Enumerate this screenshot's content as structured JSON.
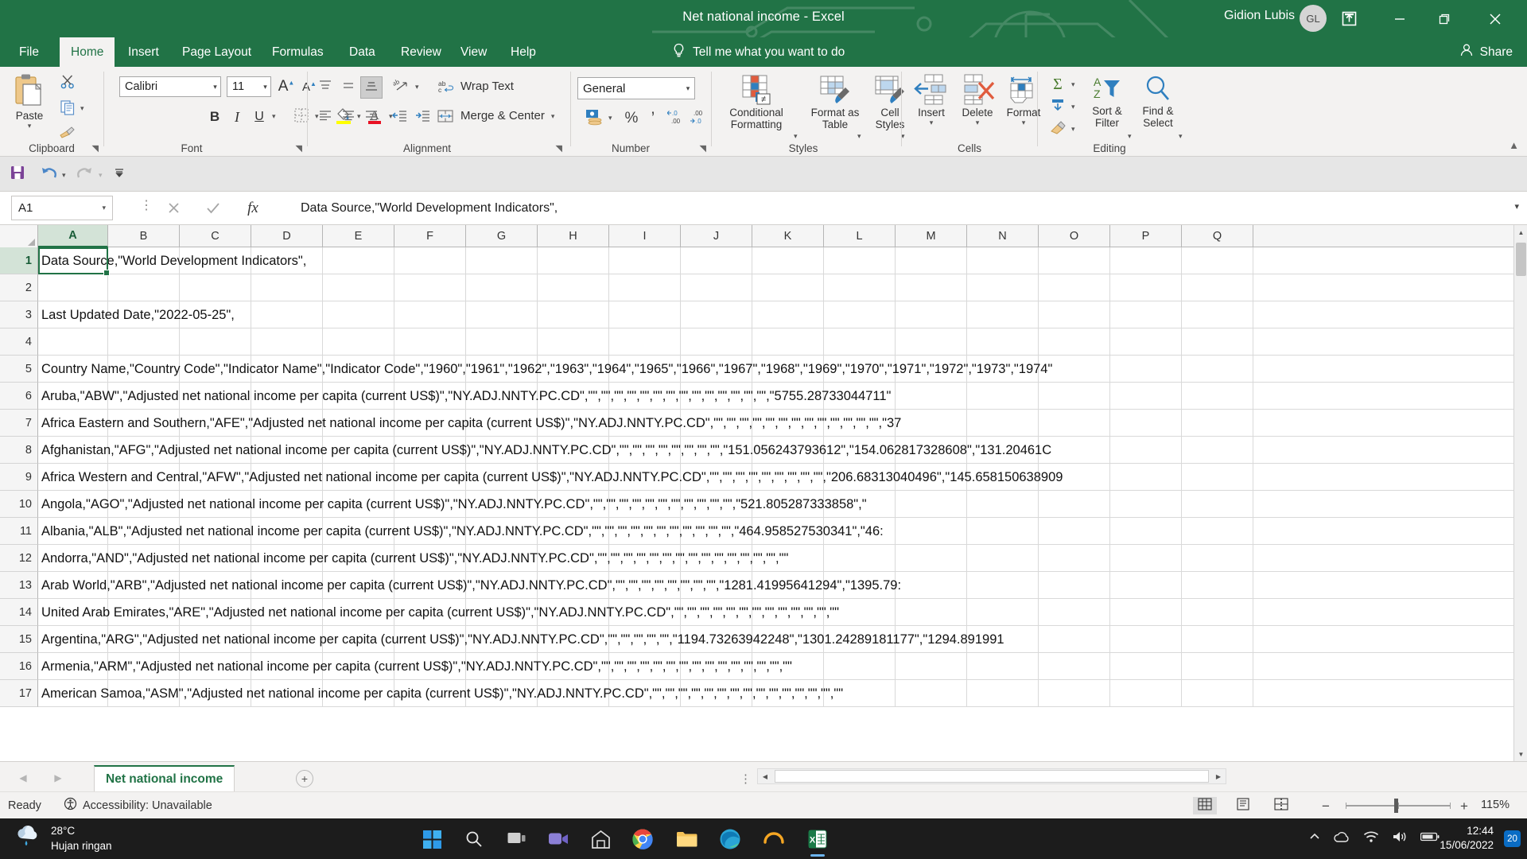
{
  "titlebar": {
    "title": "Net national income  -  Excel",
    "user": "Gidion Lubis",
    "avatar_initials": "GL",
    "ribbon_display_icon": "ribbon-display-options-icon",
    "minimize_icon": "minimize-icon",
    "restore_icon": "restore-icon",
    "close_icon": "close-icon",
    "accent_color": "#217346"
  },
  "tabs": [
    {
      "label": "File",
      "active": false
    },
    {
      "label": "Home",
      "active": true
    },
    {
      "label": "Insert",
      "active": false
    },
    {
      "label": "Page Layout",
      "active": false
    },
    {
      "label": "Formulas",
      "active": false
    },
    {
      "label": "Data",
      "active": false
    },
    {
      "label": "Review",
      "active": false
    },
    {
      "label": "View",
      "active": false
    },
    {
      "label": "Help",
      "active": false
    }
  ],
  "tellme": {
    "label": "Tell me what you want to do",
    "icon": "lightbulb-icon"
  },
  "share": {
    "label": "Share",
    "icon": "share-person-icon"
  },
  "ribbon": {
    "groups": [
      {
        "name": "Clipboard",
        "label": "Clipboard",
        "has_launcher": true
      },
      {
        "name": "Font",
        "label": "Font",
        "has_launcher": true
      },
      {
        "name": "Alignment",
        "label": "Alignment",
        "has_launcher": true
      },
      {
        "name": "Number",
        "label": "Number",
        "has_launcher": true
      },
      {
        "name": "Styles",
        "label": "Styles",
        "has_launcher": false
      },
      {
        "name": "Cells",
        "label": "Cells",
        "has_launcher": false
      },
      {
        "name": "Editing",
        "label": "Editing",
        "has_launcher": false
      }
    ],
    "clipboard": {
      "paste_label": "Paste",
      "paste_icon": "paste-clipboard-icon",
      "cut_icon": "scissors-icon",
      "copy_icon": "copy-icon",
      "format_painter_icon": "format-painter-icon"
    },
    "font": {
      "font_name": "Calibri",
      "font_size": "11",
      "grow_font_icon": "increase-font-size-icon",
      "shrink_font_icon": "decrease-font-size-icon",
      "bold_label": "B",
      "italic_label": "I",
      "underline_label": "U",
      "borders_icon": "borders-icon",
      "fill_color_icon": "fill-color-icon",
      "font_color_icon": "font-color-icon"
    },
    "alignment": {
      "top_align_icon": "align-top-icon",
      "middle_align_icon": "align-middle-icon",
      "bottom_align_icon": "align-bottom-icon",
      "orientation_icon": "text-orientation-icon",
      "wrap_text_label": "Wrap Text",
      "wrap_text_icon": "wrap-text-icon",
      "align_left_icon": "align-left-icon",
      "align_center_icon": "align-center-icon",
      "align_right_icon": "align-right-icon",
      "decrease_indent_icon": "decrease-indent-icon",
      "increase_indent_icon": "increase-indent-icon",
      "merge_center_label": "Merge & Center",
      "merge_center_icon": "merge-cells-icon"
    },
    "number": {
      "format_value": "General",
      "accounting_icon": "accounting-number-format-icon",
      "percent_label": "%",
      "comma_label": "’",
      "increase_decimal_icon": "increase-decimal-icon",
      "decrease_decimal_icon": "decrease-decimal-icon"
    },
    "styles": {
      "conditional_formatting_label": "Conditional\nFormatting",
      "conditional_formatting_l1": "Conditional",
      "conditional_formatting_l2": "Formatting",
      "conditional_formatting_icon": "conditional-formatting-icon",
      "format_as_table_l1": "Format as",
      "format_as_table_l2": "Table",
      "format_as_table_icon": "format-as-table-icon",
      "cell_styles_l1": "Cell",
      "cell_styles_l2": "Styles",
      "cell_styles_icon": "cell-styles-icon"
    },
    "cells": {
      "insert_label": "Insert",
      "insert_icon": "insert-cells-icon",
      "delete_label": "Delete",
      "delete_icon": "delete-cells-icon",
      "format_label": "Format",
      "format_icon": "format-cells-icon"
    },
    "editing": {
      "autosum_icon": "autosum-sigma-icon",
      "fill_icon": "fill-down-icon",
      "clear_icon": "clear-eraser-icon",
      "sort_filter_l1": "Sort &",
      "sort_filter_l2": "Filter",
      "sort_filter_icon": "sort-filter-icon",
      "find_select_l1": "Find &",
      "find_select_l2": "Select",
      "find_select_icon": "find-magnifier-icon"
    }
  },
  "qat": {
    "save_icon": "save-disk-icon",
    "undo_icon": "undo-arrow-icon",
    "redo_icon": "redo-arrow-icon",
    "customize_icon": "customize-qat-icon"
  },
  "formulabar": {
    "namebox_value": "A1",
    "namebox_arrow_icon": "chevron-down-icon",
    "cancel_icon": "cancel-x-icon",
    "enter_icon": "enter-check-icon",
    "function_icon": "insert-function-fx-icon",
    "formula_value": "Data Source,\"World Development Indicators\",",
    "expand_icon": "expand-formula-bar-icon"
  },
  "grid": {
    "columns": [
      "A",
      "B",
      "C",
      "D",
      "E",
      "F",
      "G",
      "H",
      "I",
      "J",
      "K",
      "L",
      "M",
      "N",
      "O",
      "P",
      "Q"
    ],
    "selected_column": "A",
    "selected_row": 1,
    "rows": [
      {
        "n": "1",
        "text": "Data Source,\"World Development Indicators\","
      },
      {
        "n": "2",
        "text": ""
      },
      {
        "n": "3",
        "text": "Last Updated Date,\"2022-05-25\","
      },
      {
        "n": "4",
        "text": ""
      },
      {
        "n": "5",
        "text": "Country Name,\"Country Code\",\"Indicator Name\",\"Indicator Code\",\"1960\",\"1961\",\"1962\",\"1963\",\"1964\",\"1965\",\"1966\",\"1967\",\"1968\",\"1969\",\"1970\",\"1971\",\"1972\",\"1973\",\"1974\""
      },
      {
        "n": "6",
        "text": "Aruba,\"ABW\",\"Adjusted net national income per capita (current US$)\",\"NY.ADJ.NNTY.PC.CD\",\"\",\"\",\"\",\"\",\"\",\"\",\"\",\"\",\"\",\"\",\"\",\"\",\"\",\"\",\"5755.28733044711\""
      },
      {
        "n": "7",
        "text": "Africa Eastern and Southern,\"AFE\",\"Adjusted net national income per capita (current US$)\",\"NY.ADJ.NNTY.PC.CD\",\"\",\"\",\"\",\"\",\"\",\"\",\"\",\"\",\"\",\"\",\"\",\"\",\"\",\"37"
      },
      {
        "n": "8",
        "text": "Afghanistan,\"AFG\",\"Adjusted net national income per capita (current US$)\",\"NY.ADJ.NNTY.PC.CD\",\"\",\"\",\"\",\"\",\"\",\"\",\"\",\"\",\"151.056243793612\",\"154.062817328608\",\"131.20461C"
      },
      {
        "n": "9",
        "text": "Africa Western and Central,\"AFW\",\"Adjusted net national income per capita (current US$)\",\"NY.ADJ.NNTY.PC.CD\",\"\",\"\",\"\",\"\",\"\",\"\",\"\",\"\",\"\",\"206.68313040496\",\"145.658150638909"
      },
      {
        "n": "10",
        "text": "Angola,\"AGO\",\"Adjusted net national income per capita (current US$)\",\"NY.ADJ.NNTY.PC.CD\",\"\",\"\",\"\",\"\",\"\",\"\",\"\",\"\",\"\",\"\",\"\",\"521.805287333858\",\""
      },
      {
        "n": "11",
        "text": "Albania,\"ALB\",\"Adjusted net national income per capita (current US$)\",\"NY.ADJ.NNTY.PC.CD\",\"\",\"\",\"\",\"\",\"\",\"\",\"\",\"\",\"\",\"\",\"\",\"464.958527530341\",\"46:"
      },
      {
        "n": "12",
        "text": "Andorra,\"AND\",\"Adjusted net national income per capita (current US$)\",\"NY.ADJ.NNTY.PC.CD\",\"\",\"\",\"\",\"\",\"\",\"\",\"\",\"\",\"\",\"\",\"\",\"\",\"\",\"\",\"\""
      },
      {
        "n": "13",
        "text": "Arab World,\"ARB\",\"Adjusted net national income per capita (current US$)\",\"NY.ADJ.NNTY.PC.CD\",\"\",\"\",\"\",\"\",\"\",\"\",\"\",\"\",\"1281.41995641294\",\"1395.79:"
      },
      {
        "n": "14",
        "text": "United Arab Emirates,\"ARE\",\"Adjusted net national income per capita (current US$)\",\"NY.ADJ.NNTY.PC.CD\",\"\",\"\",\"\",\"\",\"\",\"\",\"\",\"\",\"\",\"\",\"\",\"\",\"\""
      },
      {
        "n": "15",
        "text": "Argentina,\"ARG\",\"Adjusted net national income per capita (current US$)\",\"NY.ADJ.NNTY.PC.CD\",\"\",\"\",\"\",\"\",\"\",\"1194.73263942248\",\"1301.24289181177\",\"1294.891991"
      },
      {
        "n": "16",
        "text": "Armenia,\"ARM\",\"Adjusted net national income per capita (current US$)\",\"NY.ADJ.NNTY.PC.CD\",\"\",\"\",\"\",\"\",\"\",\"\",\"\",\"\",\"\",\"\",\"\",\"\",\"\",\"\",\"\""
      },
      {
        "n": "17",
        "text": "American Samoa,\"ASM\",\"Adjusted net national income per capita (current US$)\",\"NY.ADJ.NNTY.PC.CD\",\"\",\"\",\"\",\"\",\"\",\"\",\"\",\"\",\"\",\"\",\"\",\"\",\"\",\"\",\"\""
      }
    ]
  },
  "sheetbar": {
    "prev_icon": "previous-sheet-icon",
    "next_icon": "next-sheet-icon",
    "sheet_name": "Net national income",
    "add_sheet_icon": "add-sheet-plus-icon"
  },
  "statusbar": {
    "ready_label": "Ready",
    "accessibility_label": "Accessibility: Unavailable",
    "accessibility_icon": "accessibility-icon",
    "normal_view_icon": "normal-view-icon",
    "page_layout_icon": "page-layout-view-icon",
    "page_break_icon": "page-break-preview-icon",
    "zoom_out_label": "−",
    "zoom_in_label": "+",
    "zoom_level": "115%"
  },
  "taskbar": {
    "weather_temp": "28°C",
    "weather_desc": "Hujan ringan",
    "weather_icon": "rain-cloud-icon",
    "start_icon": "windows-start-icon",
    "search_icon": "search-magnifier-icon",
    "task_view_icon": "task-view-icon",
    "teams_icon": "teams-camera-icon",
    "store_icon": "microsoft-store-icon",
    "chrome_icon": "google-chrome-icon",
    "explorer_icon": "file-explorer-icon",
    "edge_icon": "microsoft-edge-icon",
    "browser_icon": "browser-arc-icon",
    "excel_icon": "excel-icon",
    "tray_up_icon": "show-hidden-icons-icon",
    "onedrive_icon": "onedrive-cloud-icon",
    "wifi_icon": "wifi-icon",
    "volume_icon": "volume-icon",
    "battery_icon": "battery-icon",
    "time": "12:44",
    "date": "15/06/2022",
    "notification_count": "20"
  }
}
